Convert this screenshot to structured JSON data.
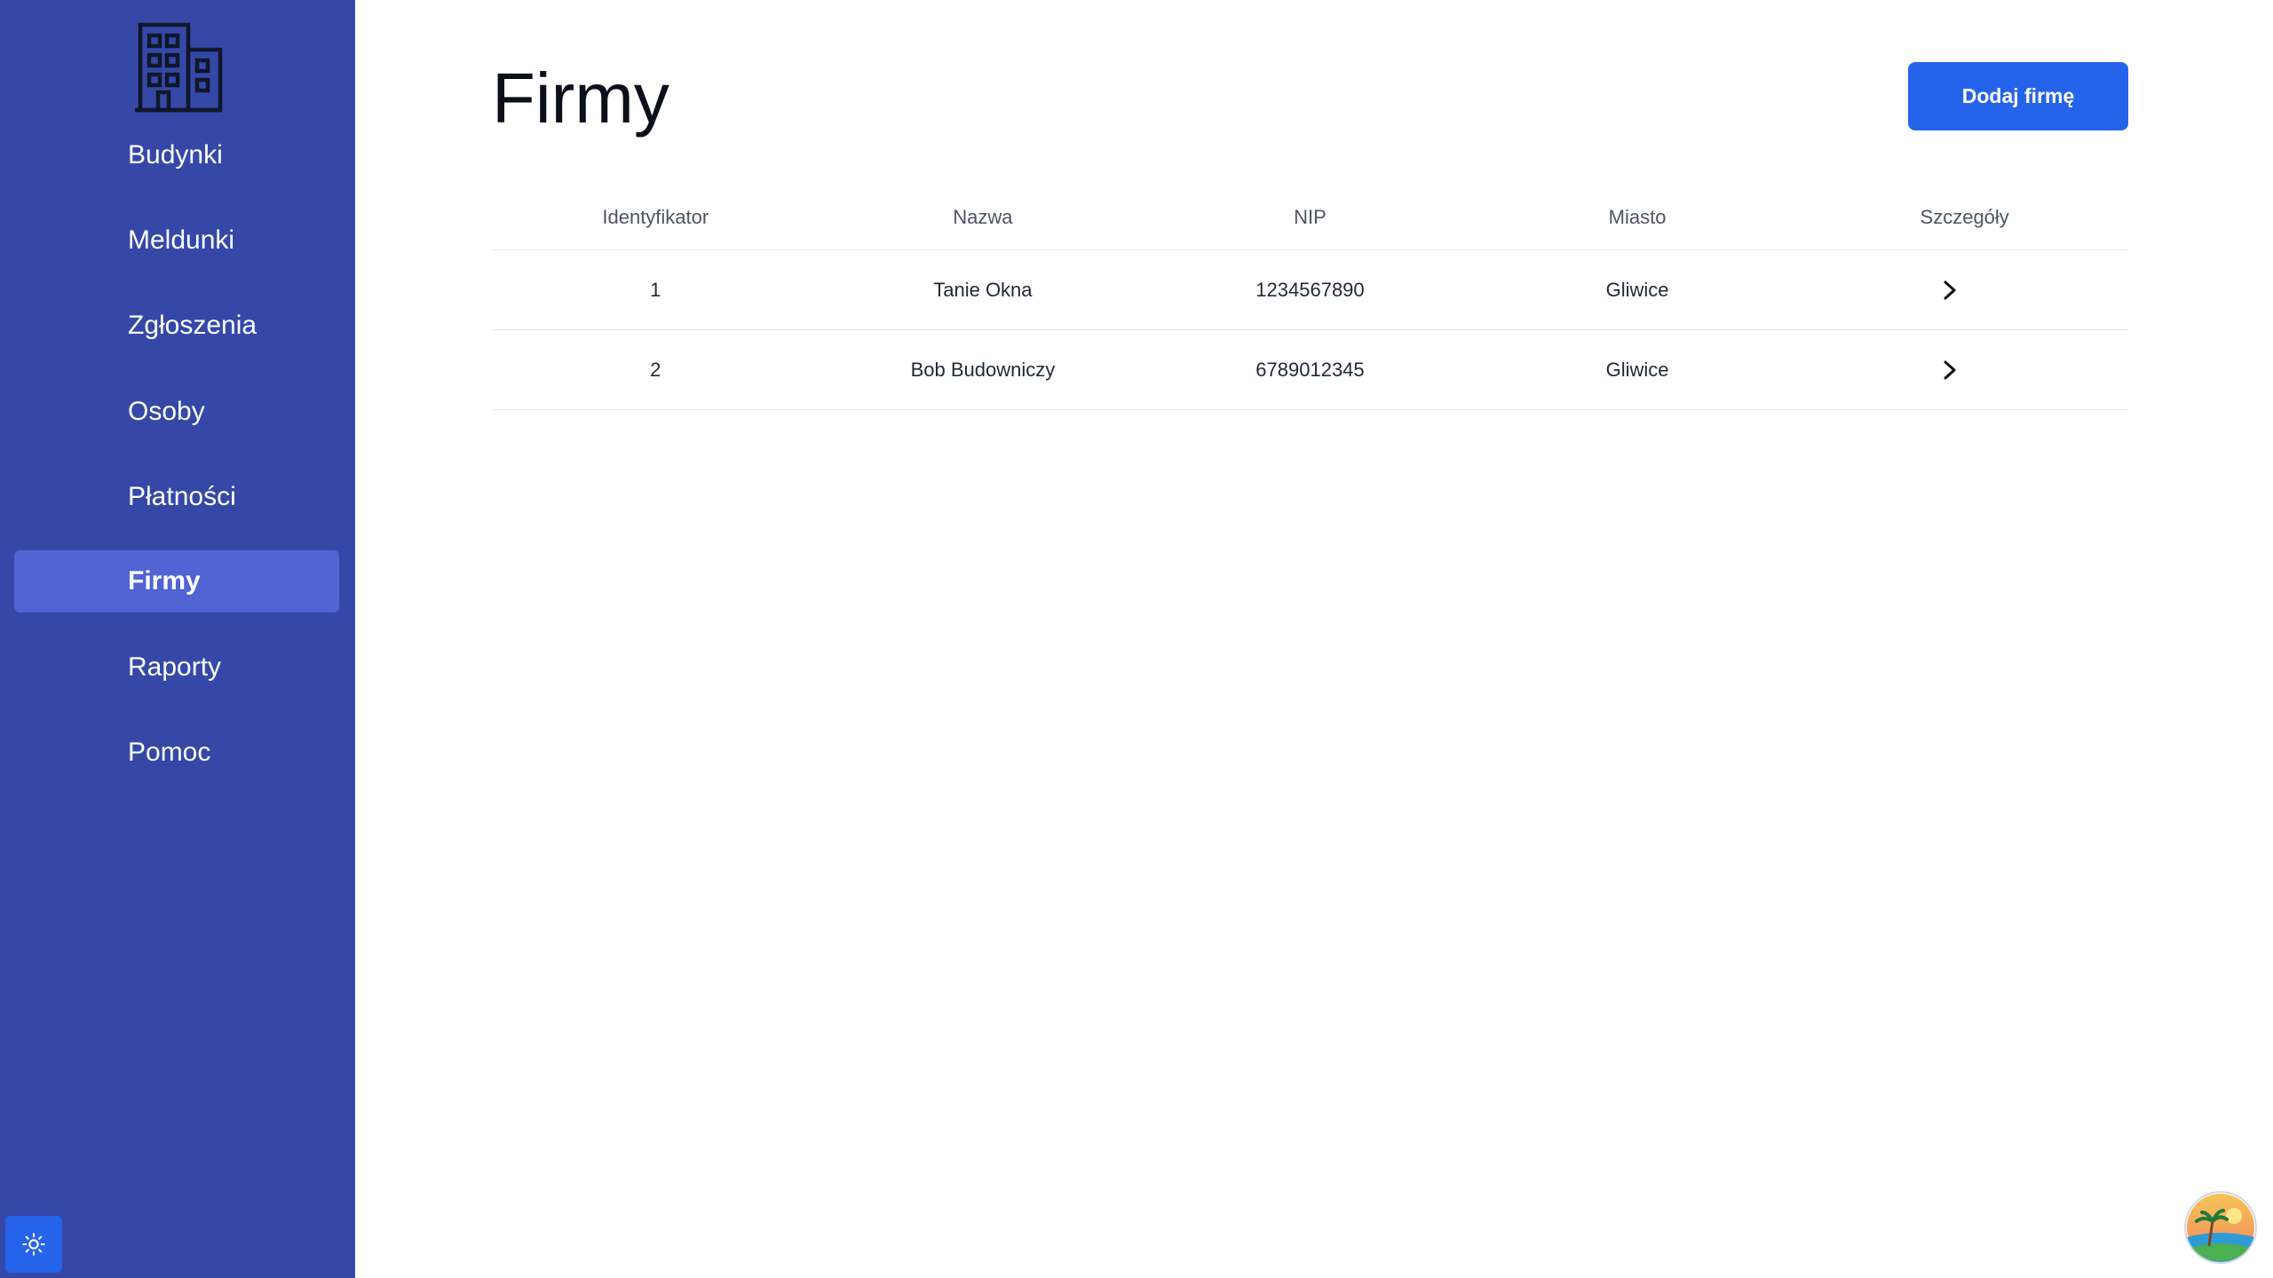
{
  "nav": {
    "items": [
      {
        "label": "Budynki"
      },
      {
        "label": "Meldunki"
      },
      {
        "label": "Zgłoszenia"
      },
      {
        "label": "Osoby"
      },
      {
        "label": "Płatności"
      },
      {
        "label": "Firmy",
        "active": true
      },
      {
        "label": "Raporty"
      },
      {
        "label": "Pomoc"
      }
    ]
  },
  "icons": {
    "logo": "building-icon",
    "theme": "sun-icon",
    "row_action": "chevron-right-icon",
    "avatar": "beach-avatar"
  },
  "colors": {
    "sidebar": "#3548a8",
    "sidebar_active": "#5263d3",
    "accent": "#2563eb"
  },
  "page": {
    "title": "Firmy",
    "add_button": "Dodaj firmę"
  },
  "table": {
    "headers": [
      "Identyfikator",
      "Nazwa",
      "NIP",
      "Miasto",
      "Szczegóły"
    ],
    "rows": [
      {
        "id": "1",
        "name": "Tanie Okna",
        "nip": "1234567890",
        "city": "Gliwice"
      },
      {
        "id": "2",
        "name": "Bob Budowniczy",
        "nip": "6789012345",
        "city": "Gliwice"
      }
    ]
  }
}
